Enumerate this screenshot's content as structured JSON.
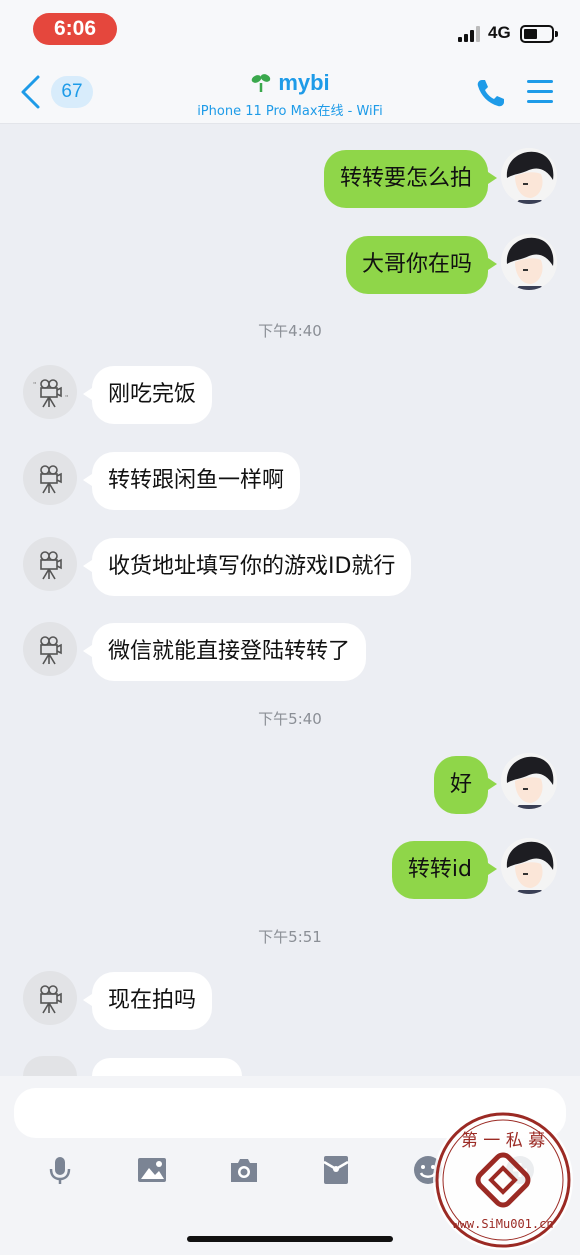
{
  "status_bar": {
    "time": "6:06",
    "network": "4G",
    "battery_level": 0.4
  },
  "nav": {
    "unread_count": "67",
    "contact_name": "mybi",
    "device_status": "iPhone 11 Pro Max在线 - WiFi",
    "accent_color": "#1e9be8"
  },
  "messages": [
    {
      "direction": "out",
      "text": "转转要怎么拍"
    },
    {
      "direction": "out",
      "text": "大哥你在吗"
    },
    {
      "type": "time",
      "text": "下午4:40"
    },
    {
      "direction": "in",
      "text": "刚吃完饭"
    },
    {
      "direction": "in",
      "text": "转转跟闲鱼一样啊"
    },
    {
      "direction": "in",
      "text": "收货地址填写你的游戏ID就行"
    },
    {
      "direction": "in",
      "text": "微信就能直接登陆转转了"
    },
    {
      "type": "time",
      "text": "下午5:40"
    },
    {
      "direction": "out",
      "text": "好"
    },
    {
      "direction": "out",
      "text": "转转id"
    },
    {
      "type": "time",
      "text": "下午5:51"
    },
    {
      "direction": "in",
      "text": "现在拍吗"
    }
  ],
  "input": {
    "value": "",
    "placeholder": ""
  },
  "toolbar": [
    "microphone-icon",
    "image-icon",
    "camera-icon",
    "red-packet-icon",
    "emoji-icon",
    "plus-icon"
  ],
  "watermark": {
    "text_top": "第 一 私 募",
    "text_bottom": "www.SiMu001.cn"
  },
  "colors": {
    "outgoing_bubble": "#8fd649",
    "incoming_bubble": "#ffffff",
    "background": "#eceef3"
  }
}
